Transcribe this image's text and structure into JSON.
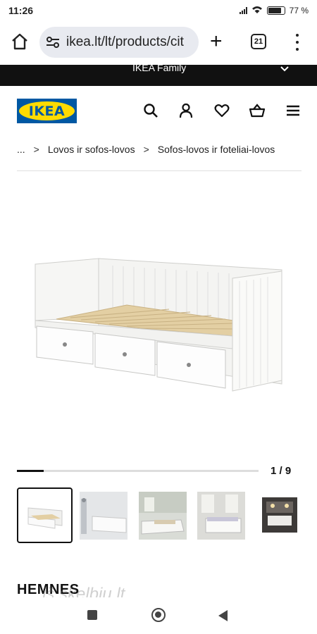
{
  "status_bar": {
    "time": "11:26",
    "battery_text": "77 %"
  },
  "browser": {
    "url": "ikea.lt/lt/products/cit",
    "tab_count": "21"
  },
  "family_bar": {
    "label": "IKEA Family"
  },
  "header": {
    "logo_text": "IKEA"
  },
  "breadcrumb": {
    "ellipsis": "...",
    "sep": ">",
    "items": [
      "Lovos ir sofos-lovos",
      "Sofos-lovos ir foteliai-lovos"
    ]
  },
  "gallery": {
    "counter": "1 / 9",
    "progress": 0.11
  },
  "product": {
    "title": "HEMNES"
  },
  "watermark": "iš skelbiu.lt"
}
